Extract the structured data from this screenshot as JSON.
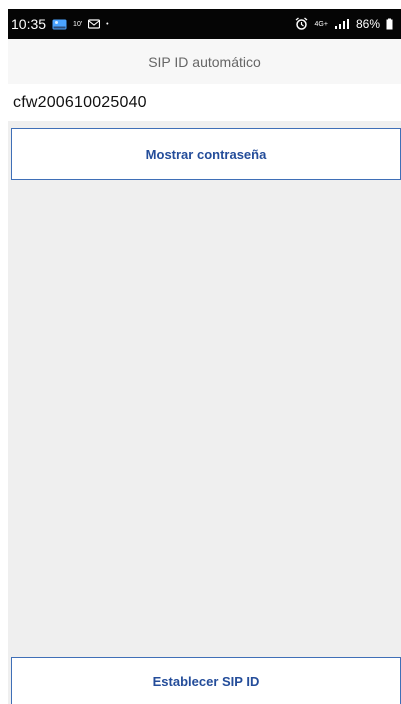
{
  "status_bar": {
    "time": "10:35",
    "small_indicator": "10'",
    "dot": "•",
    "network_label": "4G+",
    "battery": "86%",
    "icons": {
      "notification_1": "photo-icon",
      "notification_2": "mail-icon",
      "alarm": "alarm-icon",
      "signal": "signal-icon",
      "battery": "battery-icon"
    }
  },
  "header": {
    "title": "SIP ID automático"
  },
  "sip": {
    "value": "cfw200610025040"
  },
  "buttons": {
    "show_password": "Mostrar contraseña",
    "set_sip_id": "Establecer SIP ID"
  },
  "colors": {
    "accent": "#244d9a",
    "button_border": "#3f6fb7",
    "background": "#efefef",
    "status_bar": "#050505"
  }
}
